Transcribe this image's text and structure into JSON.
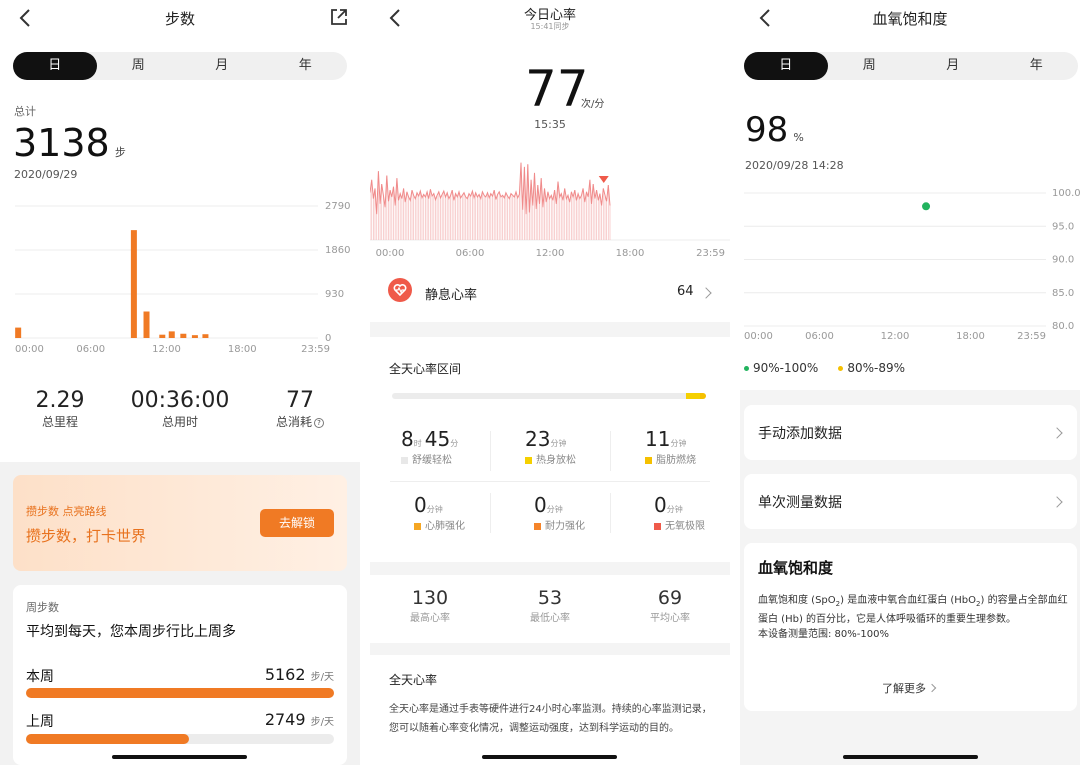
{
  "steps": {
    "title": "步数",
    "tabs": [
      "日",
      "周",
      "月",
      "年"
    ],
    "total_label": "总计",
    "total_value": "3138",
    "total_unit": "步",
    "date": "2020/09/29",
    "chart_data": {
      "type": "bar",
      "y_ticks": [
        "2790",
        "1860",
        "930",
        "0"
      ],
      "x_ticks": [
        "00:00",
        "06:00",
        "12:00",
        "18:00",
        "23:59"
      ],
      "ylim": [
        0,
        2790
      ],
      "xlim": [
        0,
        1440
      ],
      "bars": [
        {
          "x": 15,
          "value": 220
        },
        {
          "x": 565,
          "value": 2280
        },
        {
          "x": 625,
          "value": 560
        },
        {
          "x": 700,
          "value": 70
        },
        {
          "x": 745,
          "value": 140
        },
        {
          "x": 800,
          "value": 90
        },
        {
          "x": 855,
          "value": 60
        },
        {
          "x": 905,
          "value": 80
        }
      ],
      "color": "#f07a24"
    },
    "stats": [
      {
        "value": "2.29",
        "label": "总里程"
      },
      {
        "value": "00:36:00",
        "label": "总用时"
      },
      {
        "value": "77",
        "label": "总消耗"
      }
    ],
    "banner": {
      "small": "攒步数 点亮路线",
      "big": "攒步数，打卡世界",
      "button": "去解锁"
    },
    "weekly": {
      "label": "周步数",
      "headline": "平均到每天，您本周步行比上周多",
      "rows": [
        {
          "name": "本周",
          "value": "5162",
          "unit": "步/天",
          "fraction": 1.0
        },
        {
          "name": "上周",
          "value": "2749",
          "unit": "步/天",
          "fraction": 0.53
        }
      ]
    }
  },
  "heart": {
    "title": "今日心率",
    "sync": "15:41同步",
    "value": "77",
    "unit": "次/分",
    "time": "15:35",
    "chart_data": {
      "type": "line",
      "x_ticks": [
        "00:00",
        "06:00",
        "12:00",
        "18:00",
        "23:59"
      ],
      "xlim": [
        0,
        1440
      ],
      "ylim": [
        40,
        140
      ],
      "color": "#f08a8a",
      "y": [
        95,
        110,
        88,
        100,
        70,
        120,
        82,
        105,
        92,
        78,
        115,
        85,
        98,
        90,
        102,
        80,
        112,
        86,
        94,
        88,
        100,
        84,
        96,
        90,
        86,
        98,
        92,
        88,
        95,
        91,
        97,
        89,
        93,
        90,
        96,
        88,
        99,
        91,
        94,
        87,
        92,
        96,
        89,
        93,
        97,
        90,
        95,
        88,
        92,
        98,
        86,
        94,
        90,
        96,
        89,
        92,
        95,
        90,
        88,
        94,
        91,
        97,
        89,
        95,
        90,
        93,
        88,
        96,
        92,
        90,
        95,
        89,
        94,
        91,
        98,
        87,
        93,
        96,
        90,
        92,
        89,
        95,
        91,
        88,
        94,
        92,
        90,
        96,
        89,
        93,
        130,
        75,
        125,
        70,
        128,
        72,
        110,
        80,
        118,
        76,
        104,
        82,
        112,
        78,
        100,
        84,
        96,
        88,
        92,
        86,
        98,
        82,
        108,
        90,
        94,
        86,
        100,
        88,
        92,
        84,
        96,
        90,
        98,
        86,
        94,
        88,
        92,
        100,
        84,
        96,
        90,
        110,
        82,
        105,
        88,
        98,
        86,
        94,
        80,
        100,
        92,
        85,
        104,
        80
      ],
      "marker_x": 935
    },
    "resting": {
      "label": "静息心率",
      "value": "64"
    },
    "zones": {
      "title": "全天心率区间",
      "items": [
        {
          "h": "8",
          "hu": "时",
          "m": "45",
          "mu": "分",
          "label": "舒缓轻松",
          "color": "#e8e8e8"
        },
        {
          "m": "23",
          "mu": "分钟",
          "label": "热身放松",
          "color": "#f5d000"
        },
        {
          "m": "11",
          "mu": "分钟",
          "label": "脂肪燃烧",
          "color": "#f5c000"
        },
        {
          "m": "0",
          "mu": "分钟",
          "label": "心肺强化",
          "color": "#f5a623"
        },
        {
          "m": "0",
          "mu": "分钟",
          "label": "耐力强化",
          "color": "#f5842a"
        },
        {
          "m": "0",
          "mu": "分钟",
          "label": "无氧极限",
          "color": "#ef5a4a"
        }
      ]
    },
    "summary": [
      {
        "value": "130",
        "label": "最高心率"
      },
      {
        "value": "53",
        "label": "最低心率"
      },
      {
        "value": "69",
        "label": "平均心率"
      }
    ],
    "allday": {
      "title": "全天心率",
      "text": "全天心率是通过手表等硬件进行24小时心率监测。持续的心率监测记录，您可以随着心率变化情况，调整运动强度，达到科学运动的目的。"
    }
  },
  "spo2": {
    "title": "血氧饱和度",
    "tabs": [
      "日",
      "周",
      "月",
      "年"
    ],
    "value": "98",
    "unit": "%",
    "datetime": "2020/09/28 14:28",
    "chart_data": {
      "type": "scatter",
      "y_ticks": [
        "100.0",
        "95.0",
        "90.0",
        "85.0",
        "80.0"
      ],
      "x_ticks": [
        "00:00",
        "06:00",
        "12:00",
        "18:00",
        "23:59"
      ],
      "ylim": [
        80,
        100
      ],
      "xlim": [
        0,
        1440
      ],
      "points": [
        {
          "x": 868,
          "y": 98
        }
      ],
      "color": "#22b35e"
    },
    "legend": [
      {
        "label": "90%-100%",
        "color": "#22b35e"
      },
      {
        "label": "80%-89%",
        "color": "#f5c000"
      }
    ],
    "menu": [
      "手动添加数据",
      "单次测量数据"
    ],
    "info": {
      "title": "血氧饱和度",
      "p1a": "血氧饱和度 (SpO",
      "p1b": "2",
      "p1c": ") 是血液中氧合血红蛋白 (HbO",
      "p1d": "2",
      "p1e": ") 的容量占全部血红蛋白 (Hb) 的百分比，它是人体呼吸循环的重要生理参数。",
      "p2": "本设备测量范围: 80%-100%",
      "more": "了解更多"
    }
  }
}
